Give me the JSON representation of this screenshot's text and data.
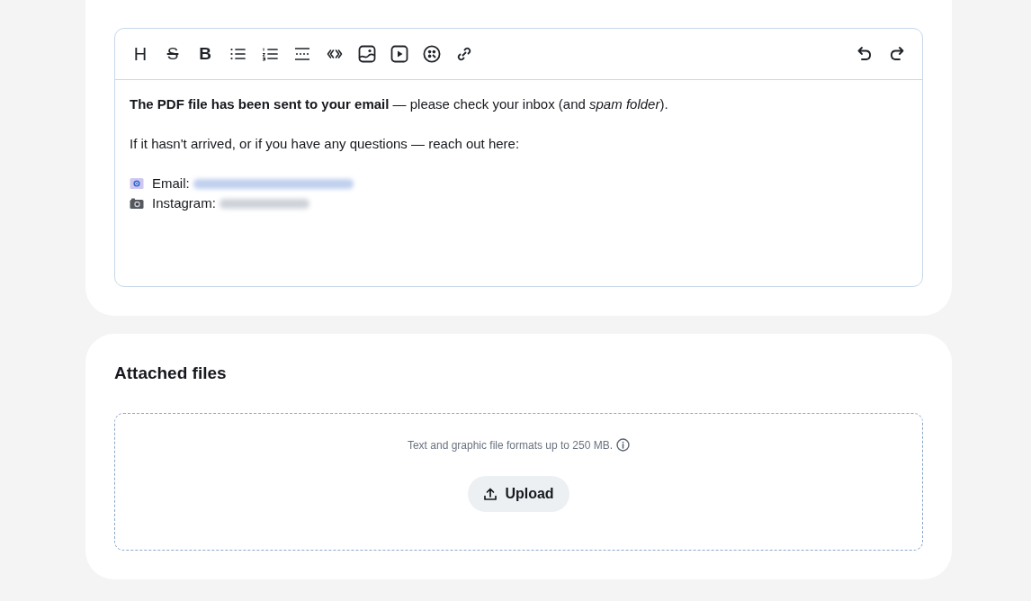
{
  "editor": {
    "toolbar": {
      "format_tools": [
        {
          "kind": "heading",
          "label": "H"
        },
        {
          "kind": "strikethrough",
          "label": "S"
        },
        {
          "kind": "bold",
          "label": "B"
        },
        {
          "kind": "bullet-list"
        },
        {
          "kind": "numbered-list"
        },
        {
          "kind": "divider"
        },
        {
          "kind": "quote"
        },
        {
          "kind": "image"
        },
        {
          "kind": "video"
        },
        {
          "kind": "embed"
        },
        {
          "kind": "link"
        }
      ],
      "history_tools": [
        {
          "kind": "undo"
        },
        {
          "kind": "redo"
        }
      ]
    },
    "content": [
      {
        "kind": "paragraph",
        "text": "**The PDF file has been sent to your email** — please check your inbox (and *spam folder*)."
      },
      {
        "kind": "paragraph",
        "text": "If it hasn't arrived, or if you have any questions — reach out here:"
      }
    ],
    "contacts": [
      {
        "kind": "mail",
        "label": "Email:"
      },
      {
        "kind": "camera",
        "label": "Instagram:"
      }
    ]
  },
  "attachments": {
    "title": "Attached files",
    "hint": "Text and graphic file formats up to 250 MB.",
    "upload_button": "Upload"
  }
}
